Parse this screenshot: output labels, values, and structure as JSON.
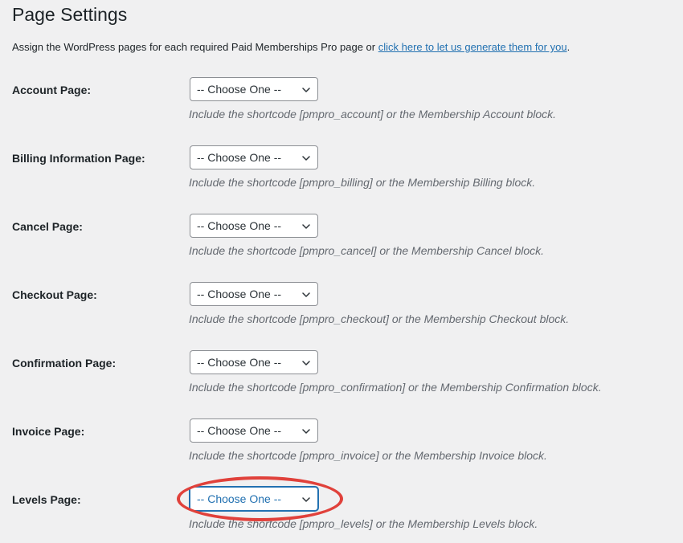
{
  "page": {
    "title": "Page Settings",
    "intro_text": "Assign the WordPress pages for each required Paid Memberships Pro page or ",
    "intro_link": "click here to let us generate them for you",
    "intro_suffix": "."
  },
  "colors": {
    "background": "#f0f0f1",
    "link": "#2271b1",
    "hint_text": "#646970",
    "highlight_circle": "#e0413b"
  },
  "settings": {
    "rows": [
      {
        "label": "Account Page:",
        "select_value": "-- Choose One --",
        "hint": "Include the shortcode [pmpro_account] or the Membership Account block."
      },
      {
        "label": "Billing Information Page:",
        "select_value": "-- Choose One --",
        "hint": "Include the shortcode [pmpro_billing] or the Membership Billing block."
      },
      {
        "label": "Cancel Page:",
        "select_value": "-- Choose One --",
        "hint": "Include the shortcode [pmpro_cancel] or the Membership Cancel block."
      },
      {
        "label": "Checkout Page:",
        "select_value": "-- Choose One --",
        "hint": "Include the shortcode [pmpro_checkout] or the Membership Checkout block."
      },
      {
        "label": "Confirmation Page:",
        "select_value": "-- Choose One --",
        "hint": "Include the shortcode [pmpro_confirmation] or the Membership Confirmation block."
      },
      {
        "label": "Invoice Page:",
        "select_value": "-- Choose One --",
        "hint": "Include the shortcode [pmpro_invoice] or the Membership Invoice block."
      },
      {
        "label": "Levels Page:",
        "select_value": "-- Choose One --",
        "hint": "Include the shortcode [pmpro_levels] or the Membership Levels block."
      }
    ]
  }
}
